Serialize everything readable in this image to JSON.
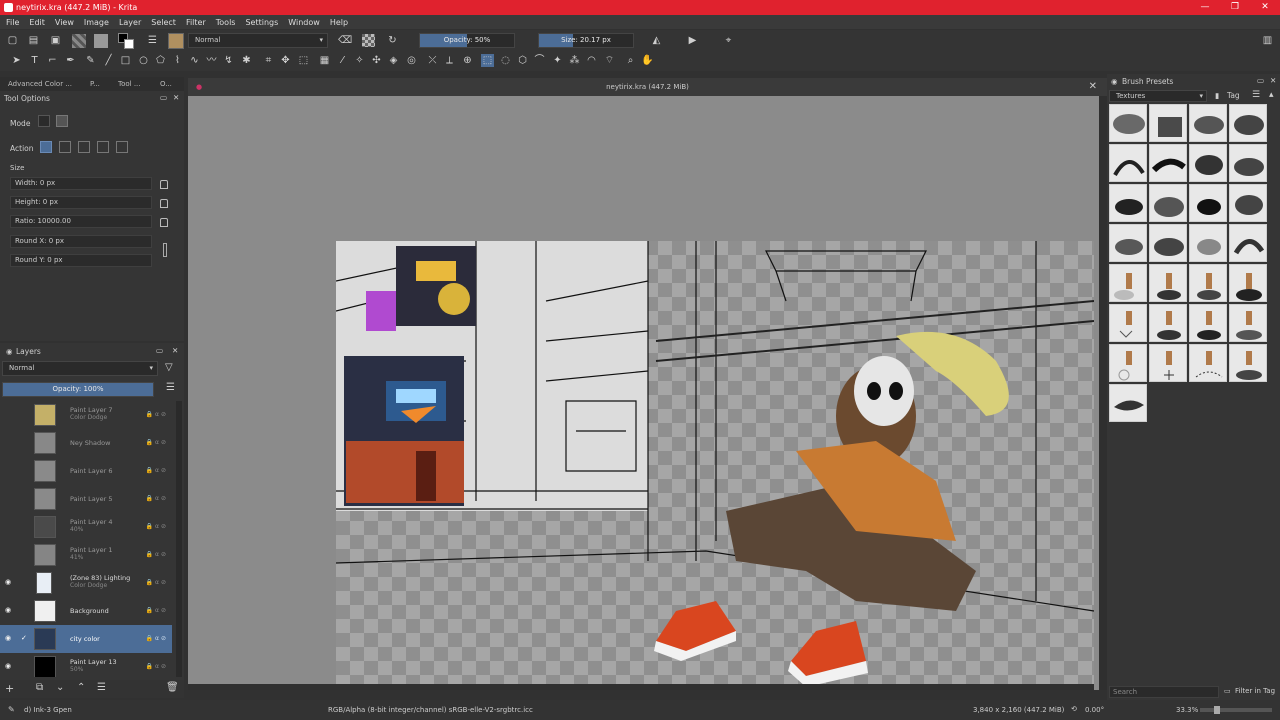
{
  "window": {
    "title": "neytirix.kra (447.2 MiB) - Krita",
    "buttons": [
      "—",
      "❐",
      "✕"
    ]
  },
  "menu": [
    "File",
    "Edit",
    "View",
    "Image",
    "Layer",
    "Select",
    "Filter",
    "Tools",
    "Settings",
    "Window",
    "Help"
  ],
  "toolbar": {
    "blend_mode": "Normal",
    "opacity_label": "Opacity: 50%",
    "opacity_fraction": 0.5,
    "size_label": "Size: 20.17 px",
    "size_fraction": 0.36
  },
  "left_tabs": [
    "Advanced Color ...",
    "P...",
    "Tool ...",
    "O..."
  ],
  "tool_options": {
    "title": "Tool Options",
    "mode_label": "Mode",
    "action_label": "Action",
    "size_label": "Size",
    "width": "Width: 0 px",
    "height": "Height: 0 px",
    "ratio": "Ratio: 10000.00",
    "round_x": "Round X: 0 px",
    "round_y": "Round Y: 0 px"
  },
  "layers": {
    "title": "Layers",
    "blend": "Normal",
    "opacity_label": "Opacity: 100%",
    "items": [
      {
        "name": "Paint Layer 7",
        "sub": "Color Dodge"
      },
      {
        "name": "Ney Shadow",
        "sub": ""
      },
      {
        "name": "Paint Layer 6",
        "sub": ""
      },
      {
        "name": "Paint Layer 5",
        "sub": ""
      },
      {
        "name": "Paint Layer 4",
        "sub": "40%"
      },
      {
        "name": "Paint Layer 1",
        "sub": "41%"
      },
      {
        "name": "(Zone 83) Lighting",
        "sub": "Color Dodge"
      },
      {
        "name": "Background",
        "sub": ""
      },
      {
        "name": "city color",
        "sub": ""
      },
      {
        "name": "Paint Layer 13",
        "sub": "50%"
      }
    ]
  },
  "canvas": {
    "doc_title": "neytirix.kra (447.2 MiB)"
  },
  "brush_presets": {
    "title": "Brush Presets",
    "tag_combo": "Textures",
    "tag_label": "Tag",
    "search_placeholder": "Search",
    "filter_label": "Filter in Tag"
  },
  "status": {
    "brush": "d) Ink-3 Gpen",
    "colorspace": "RGB/Alpha (8-bit integer/channel)  sRGB-elle-V2-srgbtrc.icc",
    "dimensions": "3,840 x 2,160 (447.2 MiB)",
    "rotation": "0.00°",
    "zoom": "33.3%"
  }
}
